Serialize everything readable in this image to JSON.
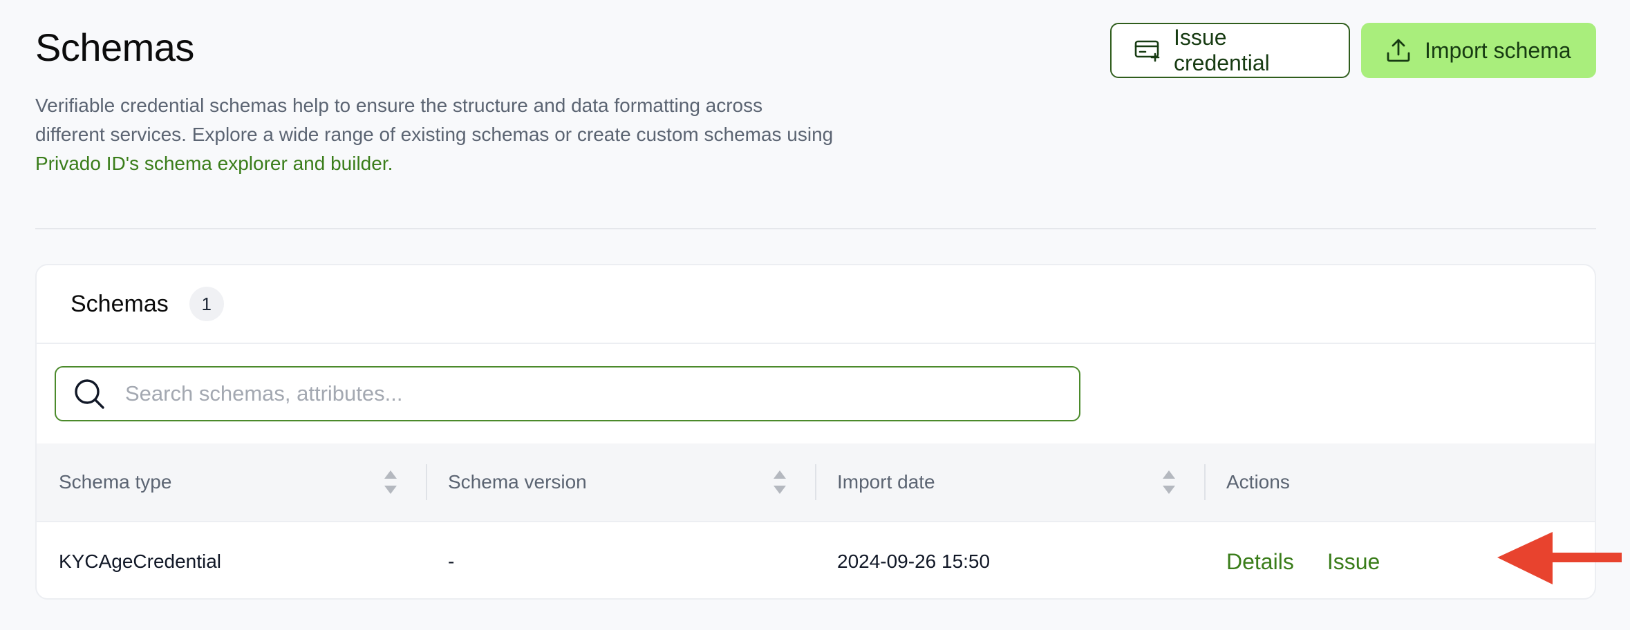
{
  "header": {
    "title": "Schemas",
    "description_text": "Verifiable credential schemas help to ensure the structure and data formatting across different services. Explore a wide range of existing schemas or create custom schemas using ",
    "description_link": "Privado ID's schema explorer and builder."
  },
  "actions": {
    "issue_credential_label": "Issue credential",
    "import_schema_label": "Import schema"
  },
  "card": {
    "title": "Schemas",
    "count": "1"
  },
  "search": {
    "placeholder": "Search schemas, attributes...",
    "value": ""
  },
  "table": {
    "columns": [
      "Schema type",
      "Schema version",
      "Import date",
      "Actions"
    ],
    "rows": [
      {
        "schema_type": "KYCAgeCredential",
        "schema_version": "-",
        "import_date": "2024-09-26 15:50",
        "actions": [
          "Details",
          "Issue"
        ]
      }
    ]
  },
  "icons": {
    "issue_credential": "credential-plus-icon",
    "import_schema": "upload-icon",
    "search": "search-icon",
    "sort": "sort-icon",
    "annotation": "red-arrow-icon"
  },
  "colors": {
    "accent_green": "#3a7d1a",
    "primary_button": "#a9ee7c",
    "annotation_arrow": "#e8432e"
  }
}
